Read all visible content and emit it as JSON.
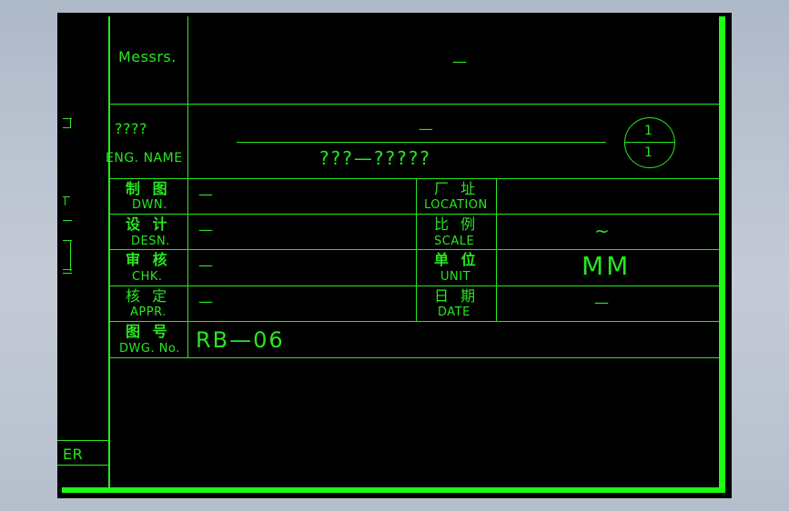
{
  "title_block": {
    "messrs_label": "Messrs.",
    "messrs_value": "—",
    "eng_name_label": "????",
    "eng_name_en": "ENG. NAME",
    "eng_name_value": "—",
    "project_value": "???—?????",
    "sheet_number": "1",
    "sheet_total": "1",
    "drawn_cn": "制 图",
    "drawn_en": "DWN.",
    "drawn_value": "—",
    "design_cn": "设 计",
    "design_en": "DESN.",
    "design_value": "—",
    "check_cn": "审 核",
    "check_en": "CHK.",
    "check_value": "—",
    "approve_cn": "核 定",
    "approve_en": "APPR.",
    "approve_value": "—",
    "dwgno_cn": "图 号",
    "dwgno_en": "DWG. No.",
    "dwgno_value": "RB—06",
    "location_cn": "厂 址",
    "location_en": "LOCATION",
    "location_value": "",
    "scale_cn": "比 例",
    "scale_en": "SCALE",
    "scale_value": "~",
    "unit_cn": "单 位",
    "unit_en": "UNIT",
    "unit_value": "MM",
    "date_cn": "日 期",
    "date_en": "DATE",
    "date_value": "—"
  },
  "left_strip": {
    "label": "ER"
  },
  "colors": {
    "line": "#27e81f",
    "border": "#1cff10",
    "canvas": "#000000"
  }
}
